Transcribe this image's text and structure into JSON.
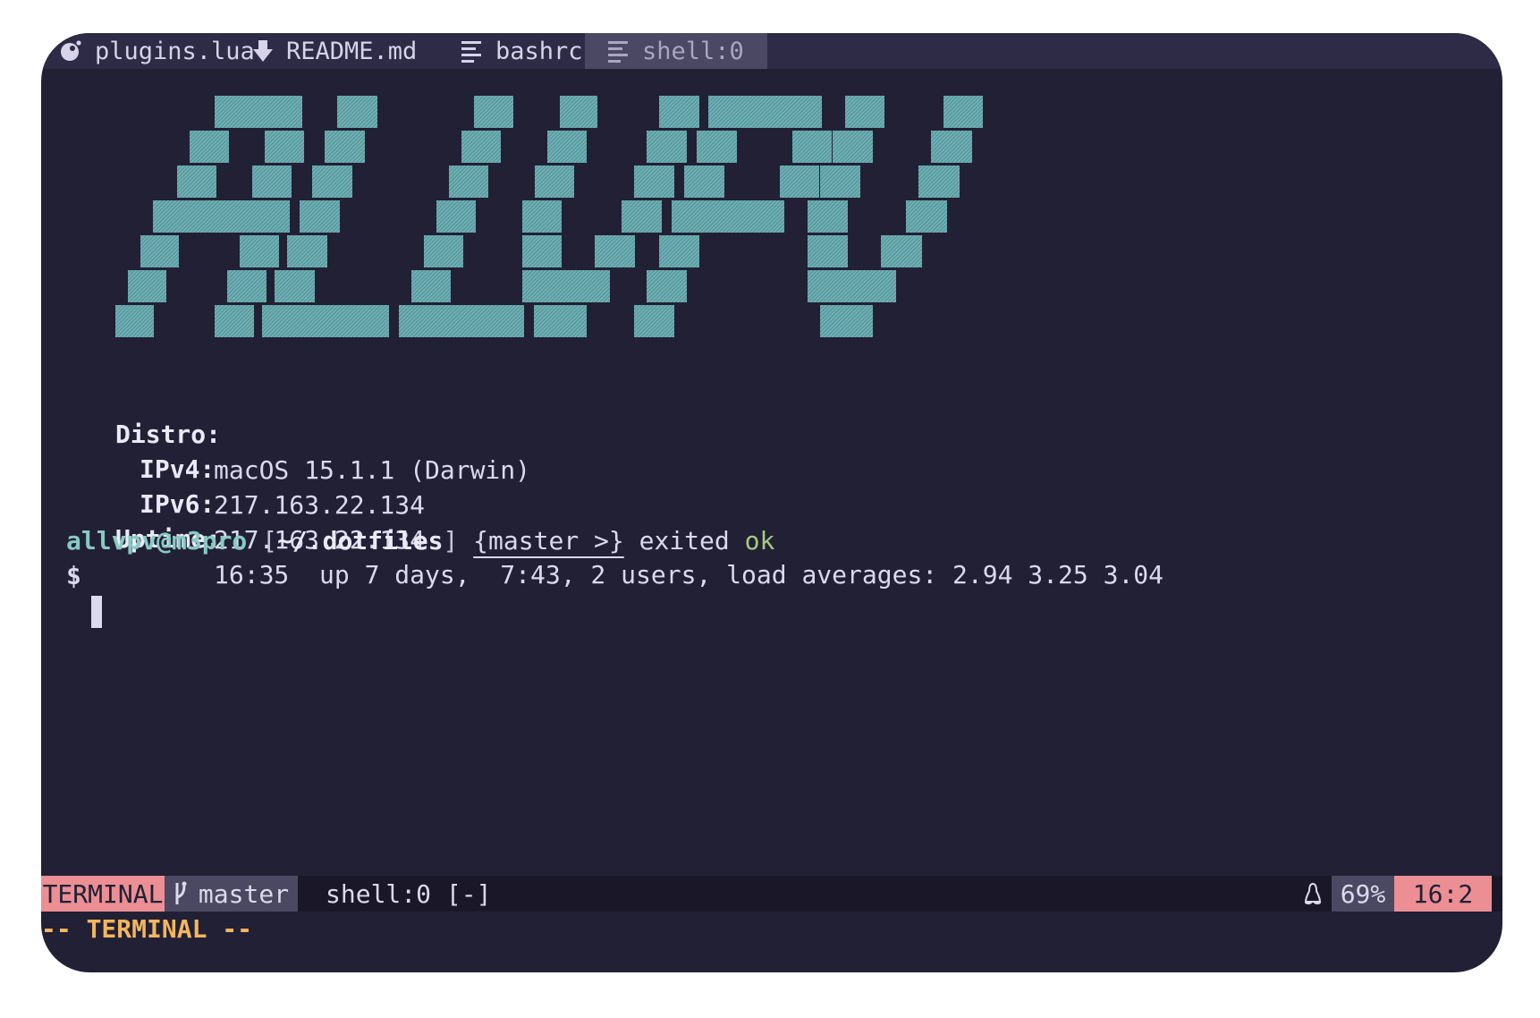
{
  "tabs": [
    {
      "icon": "lua-icon",
      "label": "plugins.lua",
      "active": false
    },
    {
      "icon": "markdown-icon",
      "label": "README.md",
      "active": false
    },
    {
      "icon": "text-file-icon",
      "label": "bashrc",
      "active": false
    },
    {
      "icon": "text-file-icon",
      "label": "shell:0",
      "active": true
    }
  ],
  "banner": {
    "art_text": "ALLVPV",
    "color": "#6fb0b4",
    "style": "hatched block letters"
  },
  "sysinfo": [
    {
      "key": "Distro:",
      "value": "macOS 15.1.1 (Darwin)"
    },
    {
      "key": "IPv4:",
      "value": "217.163.22.134"
    },
    {
      "key": "IPv6:",
      "value": "217.163.22.134"
    },
    {
      "key": "Uptime:",
      "value": "16:35  up 7 days,  7:43, 2 users, load averages: 2.94 3.25 3.04"
    }
  ],
  "prompt": {
    "user_host": "allvpv@m3pro",
    "path_open": "[",
    "path": "~/.dotfiles",
    "path_close": "]",
    "branch": "{master >}",
    "exited_label": "exited",
    "status": "ok",
    "symbol": "$"
  },
  "statusline": {
    "mode": "TERMINAL",
    "git_icon": "git-branch-icon",
    "branch": "master",
    "file": "shell:0 [-]",
    "os_icon": "linux-tux-icon",
    "percent": "69%",
    "position": "16:2"
  },
  "cmdline": "-- TERMINAL --",
  "colors": {
    "background": "#222035",
    "tabbar": "#2d2b45",
    "accent_pink": "#eb8f94",
    "cyan": "#87c9c3",
    "green": "#a5cb7e",
    "orange": "#f3b65f"
  }
}
